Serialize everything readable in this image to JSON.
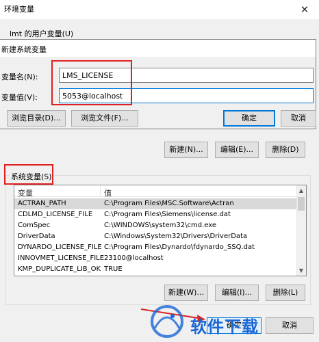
{
  "outer_window": {
    "title": "环境变量",
    "close": "✕",
    "user_group_label": "lmt 的用户变量(U)",
    "user_buttons": {
      "new": "新建(N)...",
      "edit": "编辑(E)...",
      "delete": "删除(D)"
    }
  },
  "dialog": {
    "title": "新建系统变量",
    "name_label": "变量名(N):",
    "name_value": "LMS_LICENSE",
    "value_label": "变量值(V):",
    "value_value": "5053@localhost",
    "browse_dir": "浏览目录(D)...",
    "browse_file": "浏览文件(F)...",
    "ok": "确定",
    "cancel": "取消"
  },
  "system_vars": {
    "label": "系统变量(S)",
    "columns": [
      "变量",
      "值"
    ],
    "rows": [
      {
        "name": "ACTRAN_PATH",
        "value": "C:\\Program Files\\MSC.Software\\Actran",
        "selected": true
      },
      {
        "name": "CDLMD_LICENSE_FILE",
        "value": "C:\\Program Files\\Siemens\\license.dat"
      },
      {
        "name": "ComSpec",
        "value": "C:\\WINDOWS\\system32\\cmd.exe"
      },
      {
        "name": "DriverData",
        "value": "C:\\Windows\\System32\\Drivers\\DriverData"
      },
      {
        "name": "DYNARDO_LICENSE_FILE",
        "value": "C:\\Program Files\\Dynardo\\fdynardo_SSQ.dat"
      },
      {
        "name": "INNOVMET_LICENSE_FILE",
        "value": "23100@localhost"
      },
      {
        "name": "KMP_DUPLICATE_LIB_OK",
        "value": "TRUE"
      }
    ],
    "buttons": {
      "new": "新建(W)...",
      "edit": "编辑(I)...",
      "delete": "删除(L)"
    }
  },
  "footer": {
    "ok": "确定",
    "cancel": "取消"
  },
  "watermark": {
    "text": "软件下载"
  },
  "colors": {
    "accent": "#0078d7",
    "highlight": "#e02020",
    "brand": "#1a66d6"
  }
}
